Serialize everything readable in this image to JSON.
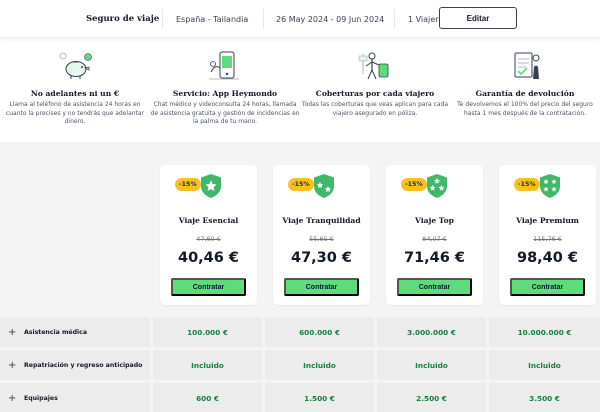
{
  "topbar": {
    "title": "Seguro de viaje",
    "route": "España - Tailandia",
    "dates": "26 May 2024 - 09 Jun 2024",
    "travelers": "1  Viajero",
    "edit_label": "Editar"
  },
  "features": [
    {
      "icon": "piggy-bank-icon",
      "title": "No adelantes ni un €",
      "desc": "Llama al teléfono de asistencia 24 horas en cuanto la precises y no tendrás que adelantar dinero."
    },
    {
      "icon": "phone-app-icon",
      "title": "Servicio: App Heymondo",
      "desc": "Chat médico y videoconsulta 24 horas, llamada de asistencia gratuita y gestión de incidencias en la palma de tu mano."
    },
    {
      "icon": "traveler-icon",
      "title": "Coberturas por cada viajero",
      "desc": "Todas las coberturas que veas aplican para cada viajero asegurado en póliza."
    },
    {
      "icon": "guarantee-document-icon",
      "title": "Garantía de devolución",
      "desc": "Te devolvemos el 100% del precio del seguro hasta 1 mes después de la contratación."
    }
  ],
  "plans": [
    {
      "discount": "-15%",
      "name": "Viaje Esencial",
      "old_price": "47,60 €",
      "price": "40,46 €",
      "cta": "Contratar",
      "stars": 1
    },
    {
      "discount": "-15%",
      "name": "Viaje Tranquilidad",
      "old_price": "55,65 €",
      "price": "47,30 €",
      "cta": "Contratar",
      "stars": 2
    },
    {
      "discount": "-15%",
      "name": "Viaje Top",
      "old_price": "84,07 €",
      "price": "71,46 €",
      "cta": "Contratar",
      "stars": 3
    },
    {
      "discount": "-15%",
      "name": "Viaje Premium",
      "old_price": "115,76 €",
      "price": "98,40 €",
      "cta": "Contratar",
      "stars": 4
    }
  ],
  "coverage": [
    {
      "label": "Asistencia médica",
      "values": [
        "100.000 €",
        "600.000 €",
        "3.000.000 €",
        "10.000.000 €"
      ]
    },
    {
      "label": "Repatriación y regreso anticipado",
      "values": [
        "Incluido",
        "Incluido",
        "Incluido",
        "Incluido"
      ]
    },
    {
      "label": "Equipajes",
      "values": [
        "600 €",
        "1.500 €",
        "2.500 €",
        "3.500 €"
      ]
    }
  ],
  "colors": {
    "accent_green": "#5ddc7d",
    "value_green": "#15803d",
    "discount_yellow": "#fbbf24",
    "shield_green": "#3fb86a"
  }
}
